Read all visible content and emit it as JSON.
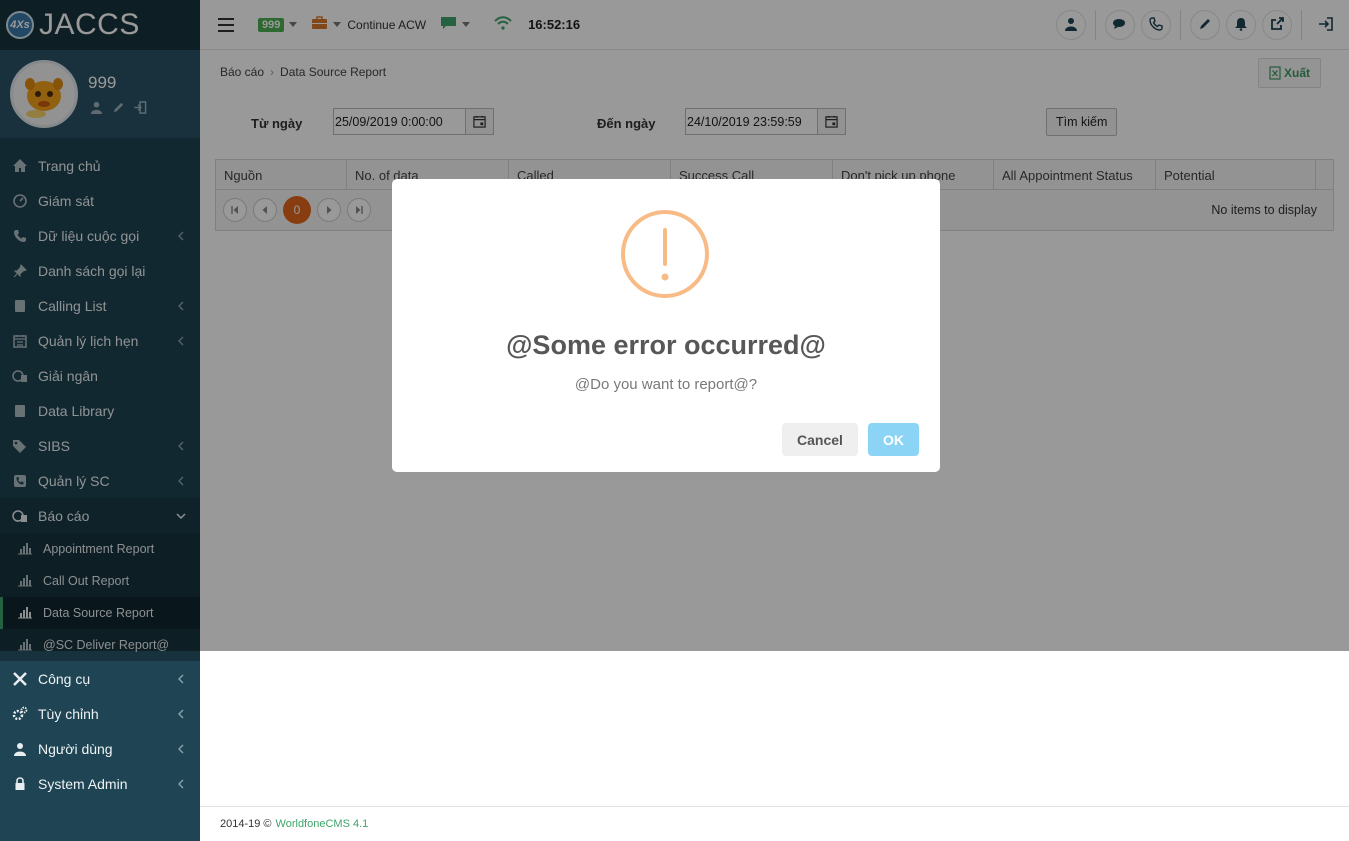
{
  "brand": {
    "badge": "4Xs",
    "name": "JACCS"
  },
  "user": {
    "name": "999"
  },
  "sidebar": {
    "items": [
      {
        "label": "Trang chủ",
        "icon": "home-icon",
        "has_submenu": false
      },
      {
        "label": "Giám sát",
        "icon": "dashboard-icon",
        "has_submenu": false
      },
      {
        "label": "Dữ liệu cuộc gọi",
        "icon": "phone-icon",
        "has_submenu": true
      },
      {
        "label": "Danh sách gọi lại",
        "icon": "pin-icon",
        "has_submenu": false
      },
      {
        "label": "Calling List",
        "icon": "book-icon",
        "has_submenu": true
      },
      {
        "label": "Quản lý lịch hẹn",
        "icon": "calendar-icon",
        "has_submenu": true
      },
      {
        "label": "Giải ngân",
        "icon": "money-icon",
        "has_submenu": false
      },
      {
        "label": "Data Library",
        "icon": "book-icon",
        "has_submenu": false
      },
      {
        "label": "SIBS",
        "icon": "tags-icon",
        "has_submenu": true
      },
      {
        "label": "Quản lý SC",
        "icon": "phone-square-icon",
        "has_submenu": true
      },
      {
        "label": "Báo cáo",
        "icon": "database-icon",
        "has_submenu": true
      }
    ],
    "report_submenu": [
      {
        "label": "Appointment Report",
        "icon": "bar-chart-icon"
      },
      {
        "label": "Call Out Report",
        "icon": "bar-chart-icon"
      },
      {
        "label": "Data Source Report",
        "icon": "bar-chart-icon"
      },
      {
        "label": "@SC Deliver Report@",
        "icon": "bar-chart-icon"
      }
    ],
    "items_after": [
      {
        "label": "Công cụ",
        "icon": "tools-icon",
        "has_submenu": true
      },
      {
        "label": "Tùy chỉnh",
        "icon": "cogs-icon",
        "has_submenu": true
      },
      {
        "label": "Người dùng",
        "icon": "user-icon",
        "has_submenu": true
      },
      {
        "label": "System Admin",
        "icon": "lock-icon",
        "has_submenu": true
      }
    ]
  },
  "topbar": {
    "extension": "999",
    "acw_label": "Continue ACW",
    "time": "16:52:16"
  },
  "breadcrumb": {
    "parent": "Báo cáo",
    "current": "Data Source Report"
  },
  "export_label": "Xuất",
  "filters": {
    "from_label": "Từ ngày",
    "from_value": "25/09/2019 0:00:00",
    "to_label": "Đến ngày",
    "to_value": "24/10/2019 23:59:59",
    "search_label": "Tìm kiếm"
  },
  "grid": {
    "columns": [
      "Nguồn",
      "No. of data",
      "Called",
      "Success Call",
      "Don't pick up phone",
      "All Appointment Status",
      "Potential"
    ],
    "current_page": "0",
    "empty_text": "No items to display"
  },
  "footer": {
    "copyright": "2014-19 ©",
    "product": "WorldfoneCMS 4.1"
  },
  "modal": {
    "title": "@Some error occurred@",
    "text": "@Do you want to report@?",
    "cancel_label": "Cancel",
    "ok_label": "OK",
    "icon": "warning-icon",
    "icon_color": "#f8bb86",
    "ok_color": "#8cd4f5"
  }
}
